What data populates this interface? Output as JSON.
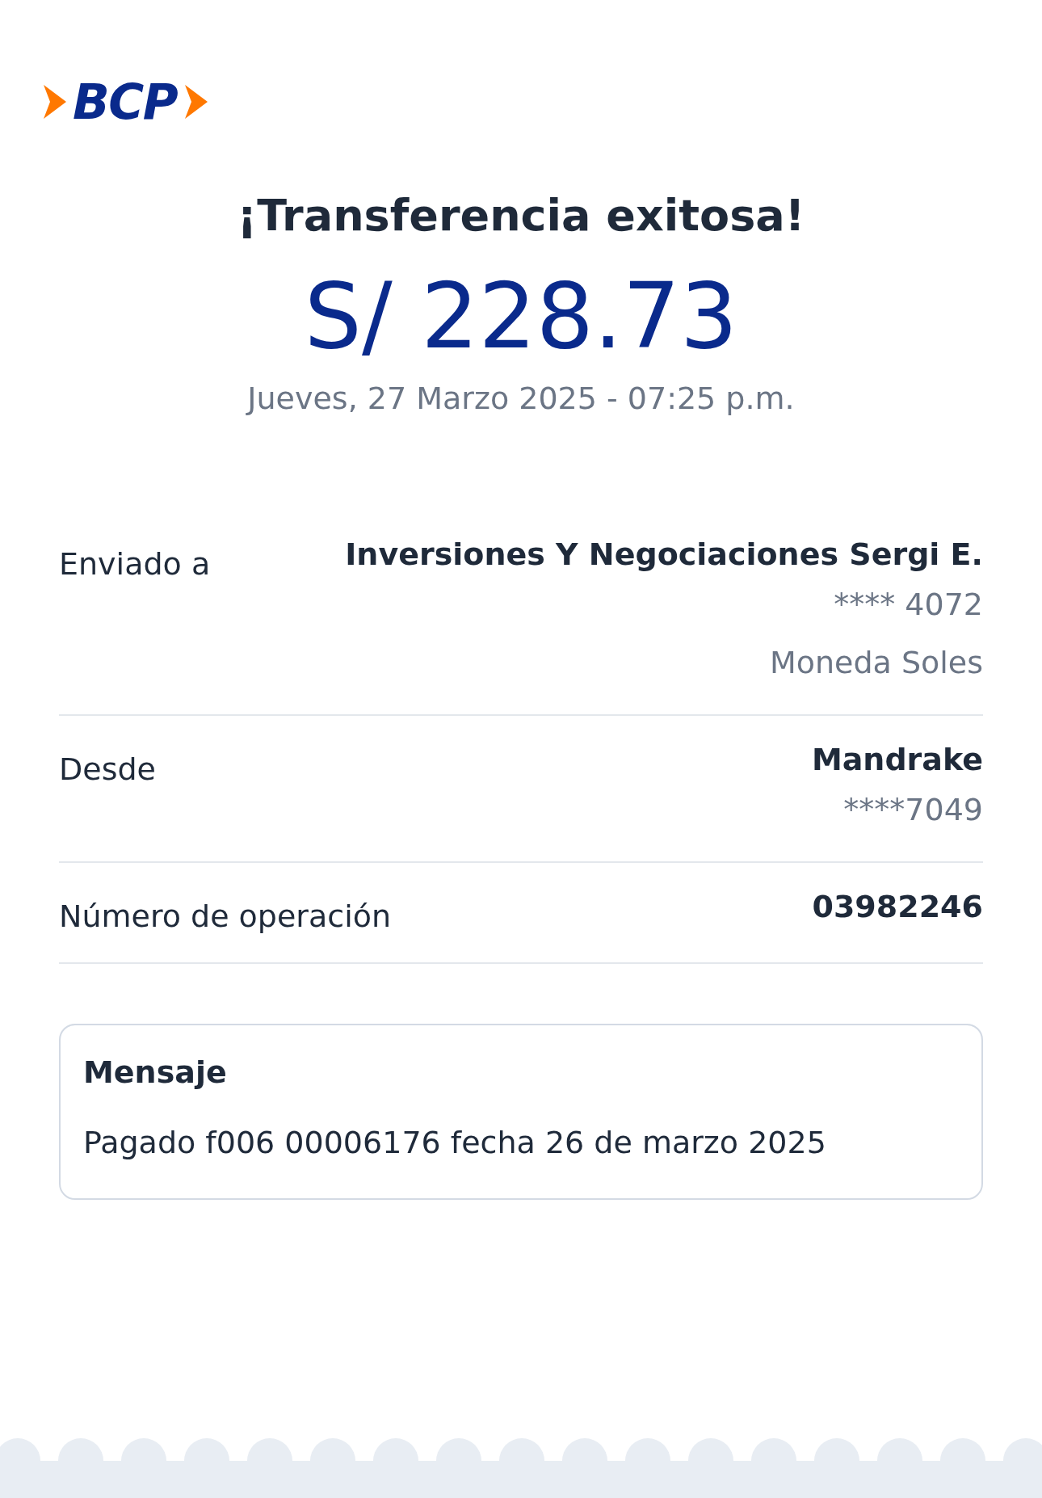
{
  "logo": {
    "text": "BCP"
  },
  "title": "¡Transferencia exitosa!",
  "amount": "S/ 228.73",
  "datetime": "Jueves, 27 Marzo 2025 - 07:25 p.m.",
  "details": [
    {
      "label": "Enviado a",
      "lines": [
        {
          "text": "Inversiones Y Negociaciones Sergi E.",
          "kind": "strong"
        },
        {
          "text": "**** 4072",
          "kind": "muted"
        },
        {
          "text": "Moneda Soles",
          "kind": "muted"
        }
      ]
    },
    {
      "label": "Desde",
      "lines": [
        {
          "text": "Mandrake",
          "kind": "strong"
        },
        {
          "text": "****7049",
          "kind": "muted"
        }
      ]
    },
    {
      "label": "Número de operación",
      "lines": [
        {
          "text": "03982246",
          "kind": "strong"
        }
      ]
    }
  ],
  "message": {
    "heading": "Mensaje",
    "text": "Pagado f006 00006176 fecha 26 de marzo 2025"
  }
}
